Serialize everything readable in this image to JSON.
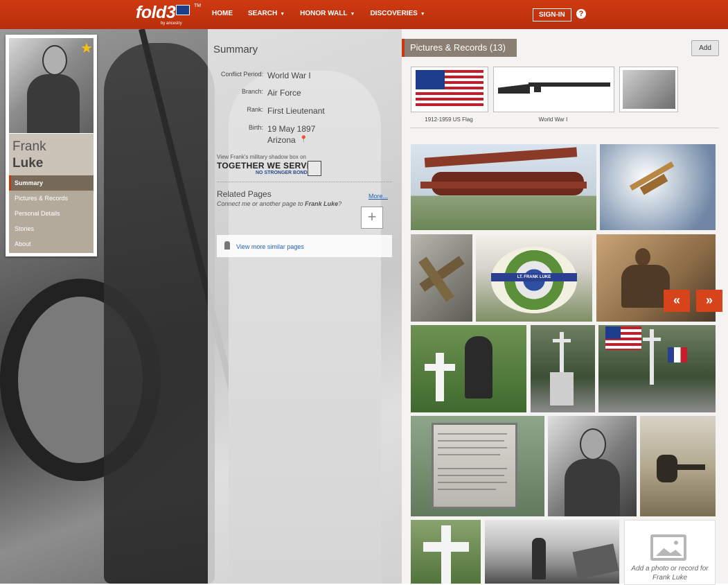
{
  "header": {
    "logo_text": "fold3",
    "logo_tm": "TM",
    "logo_sub": "by ancestry",
    "nav": [
      {
        "label": "HOME",
        "dropdown": false
      },
      {
        "label": "SEARCH",
        "dropdown": true
      },
      {
        "label": "HONOR WALL",
        "dropdown": true
      },
      {
        "label": "DISCOVERIES",
        "dropdown": true
      }
    ],
    "signin_label": "SIGN-IN",
    "help_label": "?"
  },
  "colors": {
    "header_bg": "#c8380d",
    "accent": "#d7441b",
    "link": "#1f5fb8",
    "sidebar_bg": "#b4aa9b",
    "panel_header_bg": "#8b7e72"
  },
  "profile": {
    "first_name": "Frank",
    "last_name": "Luke",
    "star_icon": "star-icon",
    "nav": [
      {
        "label": "Summary",
        "active": true
      },
      {
        "label": "Pictures & Records",
        "active": false
      },
      {
        "label": "Personal Details",
        "active": false
      },
      {
        "label": "Stories",
        "active": false
      },
      {
        "label": "About",
        "active": false
      }
    ]
  },
  "summary": {
    "title": "Summary",
    "rows": [
      {
        "label": "Conflict Period:",
        "value": "World War I"
      },
      {
        "label": "Branch:",
        "value": "Air Force"
      },
      {
        "label": "Rank:",
        "value": "First Lieutenant"
      },
      {
        "label": "Birth:",
        "value": "19 May 1897",
        "value2": "Arizona"
      }
    ],
    "shadowbox_text": "View Frank's military shadow box on",
    "twsb_main": "TOGETHER WE SERVED",
    "twsb_sub": "NO STRONGER BOND"
  },
  "related": {
    "title": "Related Pages",
    "subtitle_prefix": "Connect me or another page to ",
    "subtitle_name": "Frank Luke",
    "subtitle_suffix": "?",
    "more_label": "More...",
    "plus_label": "+",
    "similar_label": "View more similar pages"
  },
  "pictures": {
    "header": "Pictures & Records (13)",
    "add_label": "Add",
    "featured": [
      {
        "caption": "1912-1959 US Flag"
      },
      {
        "caption": "World War I"
      },
      {
        "caption": ""
      }
    ],
    "wreath_text": "LT. FRANK LUKE",
    "prev_label": "«",
    "next_label": "»",
    "add_photo_text": "Add a photo or record for",
    "add_photo_name": "Frank Luke"
  }
}
